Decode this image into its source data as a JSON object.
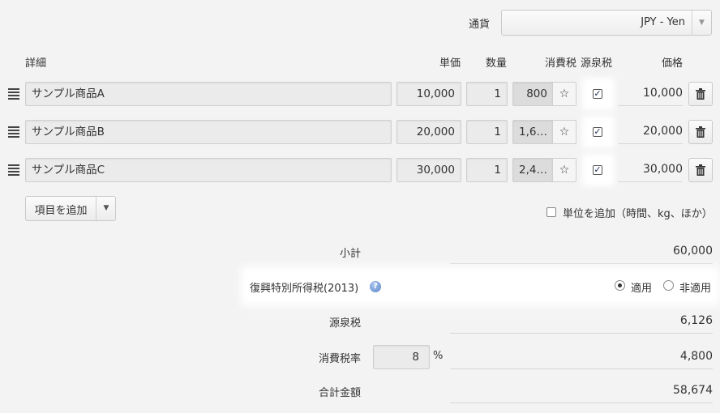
{
  "currency": {
    "label": "通貨",
    "value": "JPY - Yen"
  },
  "headers": {
    "detail": "詳細",
    "unit_price": "単価",
    "quantity": "数量",
    "consumption_tax": "消費税",
    "withholding_tax": "源泉税",
    "price": "価格"
  },
  "items": [
    {
      "description": "サンプル商品A",
      "unit_price": "10,000",
      "quantity": "1",
      "tax": "800",
      "withholding": true,
      "amount": "10,000"
    },
    {
      "description": "サンプル商品B",
      "unit_price": "20,000",
      "quantity": "1",
      "tax": "1,6…",
      "withholding": true,
      "amount": "20,000"
    },
    {
      "description": "サンプル商品C",
      "unit_price": "30,000",
      "quantity": "1",
      "tax": "2,4…",
      "withholding": true,
      "amount": "30,000"
    }
  ],
  "actions": {
    "add_item": "項目を追加",
    "add_unit": "単位を追加（時間、kg、ほか）"
  },
  "summary": {
    "subtotal_label": "小計",
    "subtotal_value": "60,000",
    "reconstruction_label": "復興特別所得税(2013)",
    "reconstruction_options": {
      "apply": "適用",
      "not_apply": "非適用",
      "selected": "apply"
    },
    "withholding_label": "源泉税",
    "withholding_value": "6,126",
    "tax_rate_label": "消費税率",
    "tax_rate_value": "8",
    "tax_rate_unit": "%",
    "tax_rate_amount": "4,800",
    "total_label": "合計金額",
    "total_value": "58,674"
  },
  "colors": {
    "background": "#f3f3f3",
    "checkbox_mark": "#1a2a55",
    "help_icon": "#5a86c8"
  }
}
